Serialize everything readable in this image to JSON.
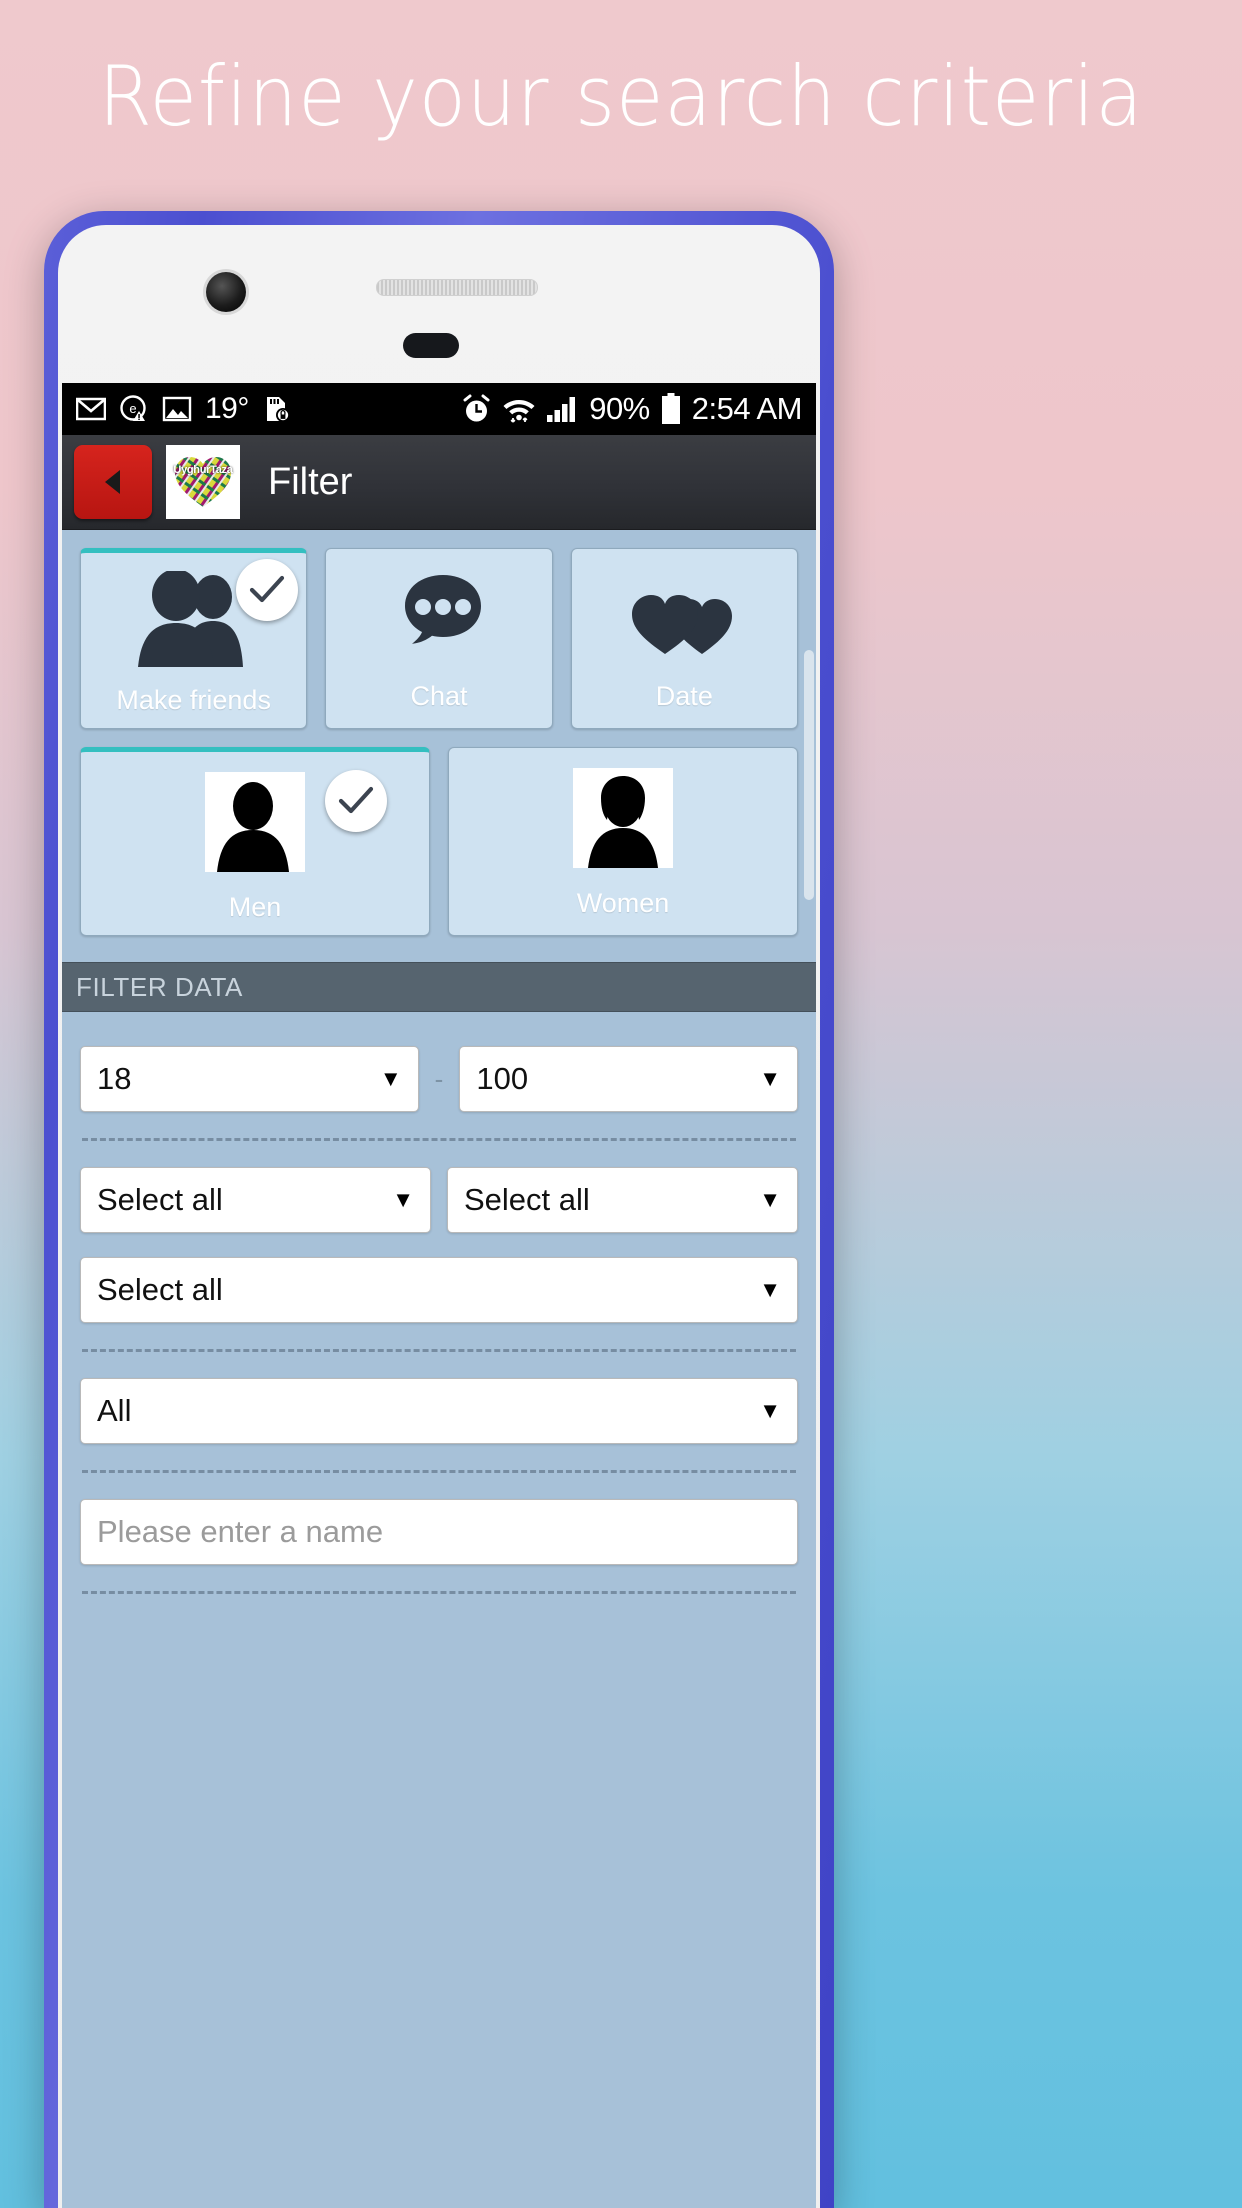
{
  "promo": {
    "headline": "Refine your search criteria"
  },
  "statusbar": {
    "icons_left": [
      "gmail-icon",
      "warning-badge-icon",
      "photo-icon",
      "temperature",
      "sdcard-lock-icon"
    ],
    "temperature": "19°",
    "battery_percent": "90%",
    "clock": "2:54 AM",
    "icons_right": [
      "alarm-icon",
      "wifi-icon",
      "signal-icon",
      "battery-icon"
    ]
  },
  "appbar": {
    "back_label": "◀",
    "logo_text": "UyghurTaza",
    "title": "Filter"
  },
  "purpose_tiles": [
    {
      "label": "Make friends",
      "icon": "two-people-icon",
      "selected": true
    },
    {
      "label": "Chat",
      "icon": "chat-bubble-icon",
      "selected": false
    },
    {
      "label": "Date",
      "icon": "two-hearts-icon",
      "selected": false
    }
  ],
  "gender_tiles": [
    {
      "label": "Men",
      "icon": "man-photo-icon",
      "selected": true
    },
    {
      "label": "Women",
      "icon": "woman-photo-icon",
      "selected": false
    }
  ],
  "section": {
    "filter_data_title": "FILTER DATA"
  },
  "fields": {
    "age_min": "18",
    "age_max": "100",
    "range_separator": "-",
    "country": "Select all",
    "region": "Select all",
    "city": "Select all",
    "extra": "All",
    "name_placeholder": "Please enter a name",
    "name_value": "",
    "caret": "▼"
  },
  "colors": {
    "accent_teal": "#34bfc0",
    "tile_bg": "#cfe2f1",
    "screen_bg": "#a7c1d8",
    "section_bar": "#56646f",
    "back_button_red": "#c71c16",
    "phone_frame": "#4b4fd0"
  }
}
